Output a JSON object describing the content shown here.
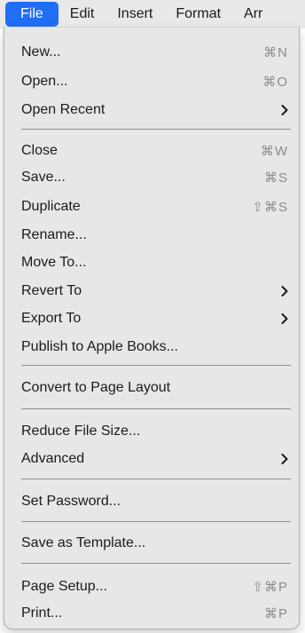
{
  "menubar": {
    "items": [
      "File",
      "Edit",
      "Insert",
      "Format",
      "Arr"
    ]
  },
  "menu": {
    "items": [
      {
        "label": "New...",
        "shortcut": "⌘N"
      },
      {
        "label": "Open...",
        "shortcut": "⌘O"
      },
      {
        "label": "Open Recent",
        "submenu": true
      },
      {
        "label": "Close",
        "shortcut": "⌘W"
      },
      {
        "label": "Save...",
        "shortcut": "⌘S"
      },
      {
        "label": "Duplicate",
        "shortcut": "⇧⌘S"
      },
      {
        "label": "Rename..."
      },
      {
        "label": "Move To..."
      },
      {
        "label": "Revert To",
        "submenu": true
      },
      {
        "label": "Export To",
        "submenu": true
      },
      {
        "label": "Publish to Apple Books..."
      },
      {
        "label": "Convert to Page Layout"
      },
      {
        "label": "Reduce File Size..."
      },
      {
        "label": "Advanced",
        "submenu": true
      },
      {
        "label": "Set Password..."
      },
      {
        "label": "Save as Template..."
      },
      {
        "label": "Page Setup...",
        "shortcut": "⇧⌘P"
      },
      {
        "label": "Print...",
        "shortcut": "⌘P"
      }
    ]
  },
  "colors": {
    "accent": "#1f6ef5",
    "menu_bg": "#e7e7e7",
    "shortcut_text": "#8c8c8c"
  }
}
